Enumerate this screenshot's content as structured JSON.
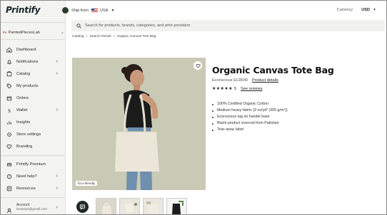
{
  "brand": {
    "logo_text": "Printify"
  },
  "sidebar": {
    "shop": {
      "prefix": "Pe",
      "name": "PaintedPiecesLab"
    },
    "items": [
      {
        "label": "Dashboard",
        "icon": "home-icon",
        "arrow": ""
      },
      {
        "label": "Notifications",
        "icon": "bell-icon",
        "arrow": "›"
      },
      {
        "label": "Catalog",
        "icon": "catalog-icon",
        "arrow": "›"
      },
      {
        "label": "My products",
        "icon": "tag-icon",
        "arrow": ""
      },
      {
        "label": "Orders",
        "icon": "box-icon",
        "arrow": ""
      },
      {
        "label": "Wallet",
        "icon": "wallet-icon",
        "arrow": "›"
      },
      {
        "label": "Insights",
        "icon": "insights-icon",
        "arrow": ""
      },
      {
        "label": "Store settings",
        "icon": "gear-icon",
        "arrow": ""
      },
      {
        "label": "Branding",
        "icon": "heart-icon",
        "arrow": ""
      }
    ],
    "bottom_items": [
      {
        "label": "Printify Premium",
        "icon": "crown-icon",
        "arrow": ""
      },
      {
        "label": "Need help?",
        "icon": "help-icon",
        "arrow": "›"
      },
      {
        "label": "Resources",
        "icon": "resources-icon",
        "arrow": "›"
      }
    ],
    "account": {
      "label": "Account",
      "email": "brainsp2@gmail.com",
      "arrow": "›"
    }
  },
  "topbar": {
    "ship_from_label": "Ship from",
    "ship_from_value": "USA",
    "currency_label": "Currency",
    "currency_value": "USD"
  },
  "search": {
    "placeholder": "Search for products, brands, categories, and print providers"
  },
  "breadcrumb": [
    "Catalog",
    "/",
    "Search Result",
    "/",
    "Organic Canvas Tote Bag"
  ],
  "product": {
    "title": "Organic Canvas Tote Bag",
    "brand": "Econscious EC8040",
    "details_link": "Product details",
    "stars": "★★★★★",
    "rating": "5",
    "reviews_link": "See reviews",
    "image_tag": "Eco-friendly",
    "features": [
      "100% Certified Organic Cotton",
      "Medium heavy fabric (9 oz/yd² (305 g/m²))",
      "Econscious tag on handle base",
      "Blank product sourced from Pakistan",
      "Tear-away label"
    ]
  },
  "colors": {
    "sidebar_bg": "#f3f3ef",
    "image_bg": "#c9cbb8",
    "dark": "#1f2a26"
  }
}
